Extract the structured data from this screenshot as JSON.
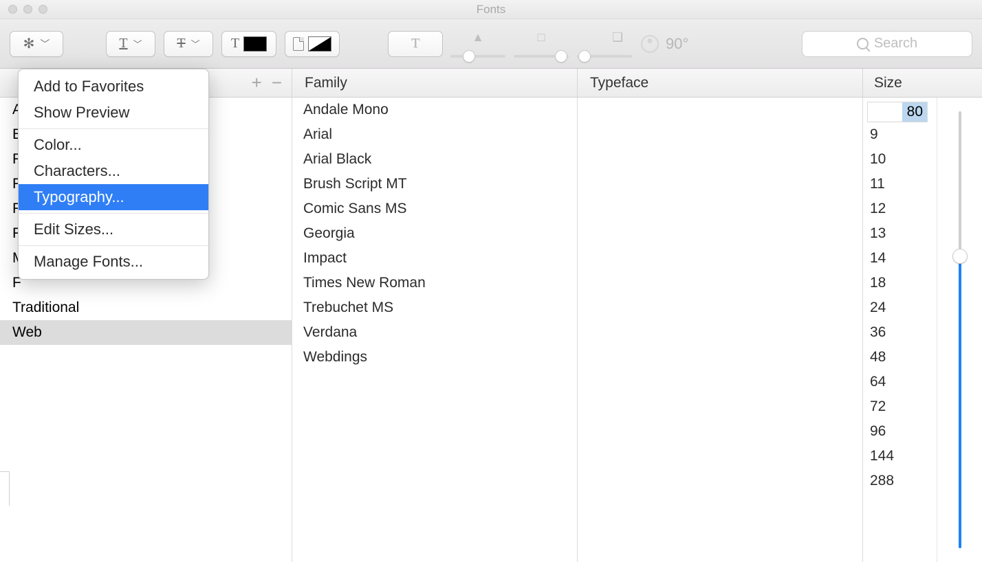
{
  "window": {
    "title": "Fonts"
  },
  "toolbar": {
    "angle_label": "90°",
    "search_placeholder": "Search"
  },
  "headers": {
    "family": "Family",
    "typeface": "Typeface",
    "size": "Size",
    "plus": "+",
    "minus": "−"
  },
  "collections": {
    "peek_letters": [
      "A",
      "E",
      "F",
      "F",
      "F",
      "F",
      "M",
      "F"
    ],
    "visible_items": [
      "Traditional",
      "Web"
    ],
    "selected": "Web"
  },
  "families": [
    "Andale Mono",
    "Arial",
    "Arial Black",
    "Brush Script MT",
    "Comic Sans MS",
    "Georgia",
    "Impact",
    "Times New Roman",
    "Trebuchet MS",
    "Verdana",
    "Webdings"
  ],
  "size": {
    "input_value": "80",
    "options": [
      "9",
      "10",
      "11",
      "12",
      "13",
      "14",
      "18",
      "24",
      "36",
      "48",
      "64",
      "72",
      "96",
      "144",
      "288"
    ]
  },
  "menu": {
    "items": [
      {
        "label": "Add to Favorites",
        "highlight": false
      },
      {
        "label": "Show Preview",
        "highlight": false
      },
      {
        "sep": true
      },
      {
        "label": "Color...",
        "highlight": false
      },
      {
        "label": "Characters...",
        "highlight": false
      },
      {
        "label": "Typography...",
        "highlight": true
      },
      {
        "sep": true
      },
      {
        "label": "Edit Sizes...",
        "highlight": false
      },
      {
        "sep": true
      },
      {
        "label": "Manage Fonts...",
        "highlight": false
      }
    ]
  }
}
